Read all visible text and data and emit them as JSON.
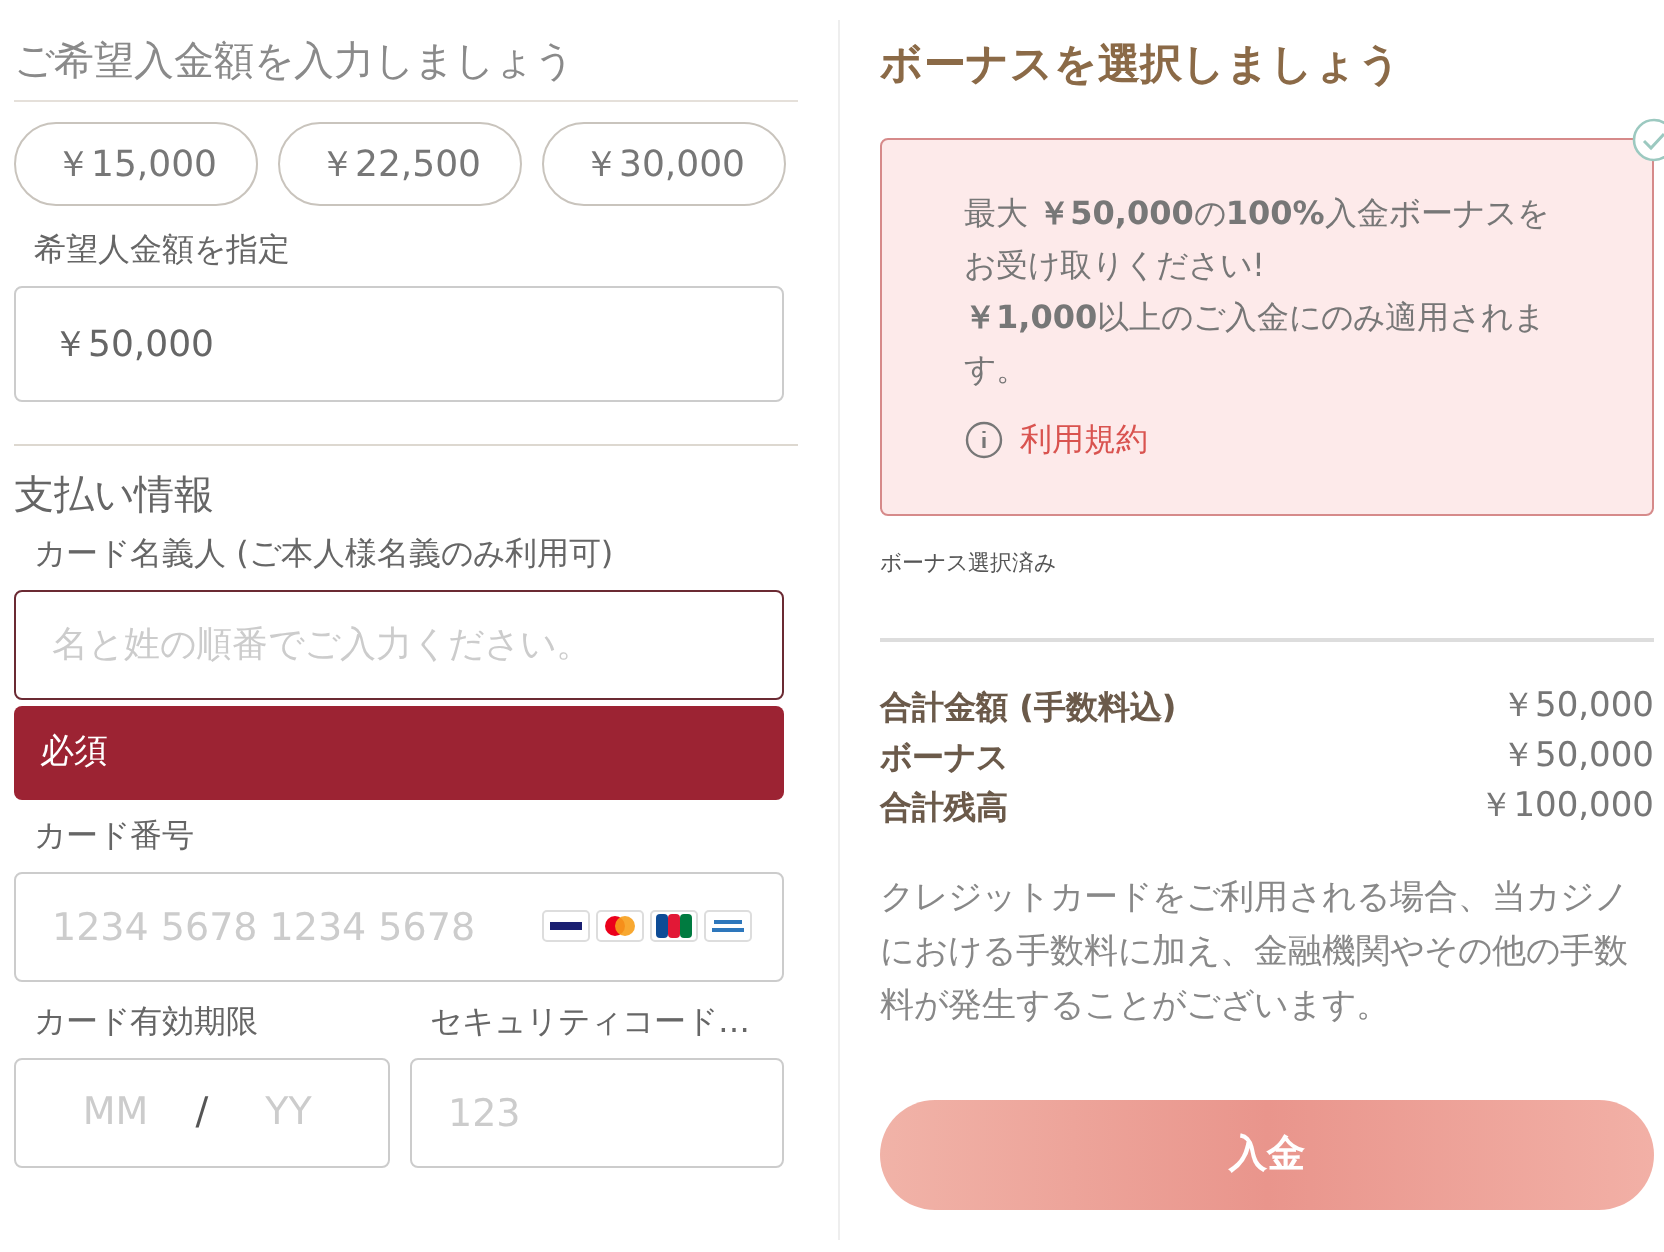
{
  "deposit": {
    "title": "ご希望入金額を入力しましょう",
    "presets": [
      {
        "label": "￥15,000",
        "selected": false
      },
      {
        "label": "￥22,500",
        "selected": false
      },
      {
        "label": "￥30,000",
        "selected": false
      }
    ],
    "amount_label": "希望人金額を指定",
    "amount_value": "￥50,000"
  },
  "payment": {
    "title": "支払い情報",
    "holder_label": "カード名義人 (ご本人様名義のみ利用可)",
    "holder_placeholder": "名と姓の順番でご入力ください。",
    "holder_error": "必須",
    "number_label": "カード番号",
    "number_placeholder": "1234 5678 1234 5678",
    "expiry_label": "カード有効期限",
    "month_placeholder": "MM",
    "separator": "/",
    "year_placeholder": "YY",
    "cvc_label": "セキュリティコード…",
    "cvc_placeholder": "123"
  },
  "bonus": {
    "title": "ボーナスを選択しましょう",
    "offers": [
      {
        "text": "最大 **￥50,000**の**100%**入金ボーナスをお受け取りください!",
        "condition": "**￥1,000**以上のご入金にのみ適用されます。",
        "terms": "利用規約",
        "selected": true
      }
    ],
    "status": "ボーナス選択済み"
  },
  "summary": {
    "rows": [
      {
        "label": "合計金額 (手数料込)",
        "value": "￥50,000"
      },
      {
        "label": "ボーナス",
        "value": "￥50,000"
      },
      {
        "label": "合計残高",
        "value": "￥100,000"
      }
    ],
    "note": "クレジットカードをご利用される場合、当カジノにおける手数料に加え、金融機関やその他の手数料が発生することがございます。",
    "submit": {
      "label": "入金",
      "disabled": true
    }
  }
}
